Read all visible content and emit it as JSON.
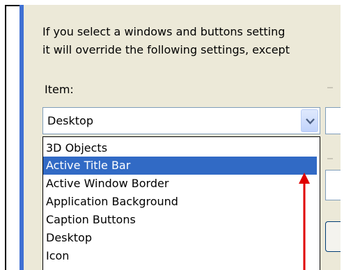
{
  "description": {
    "line1": "If you select a windows and buttons setting",
    "line2": "it will override the following settings, except"
  },
  "item": {
    "label": "Item:",
    "selected_value": "Desktop"
  },
  "dropdown": {
    "options": [
      "3D Objects",
      "Active Title Bar",
      "Active Window Border",
      "Application Background",
      "Caption Buttons",
      "Desktop",
      "Icon"
    ],
    "highlighted": "Active Title Bar"
  },
  "annotation": {
    "icon": "pointer-arrow-icon",
    "color": "#e00000"
  },
  "colors": {
    "panel": "#ece9d8",
    "accent": "#3f70d3",
    "highlight": "#316ac5"
  }
}
